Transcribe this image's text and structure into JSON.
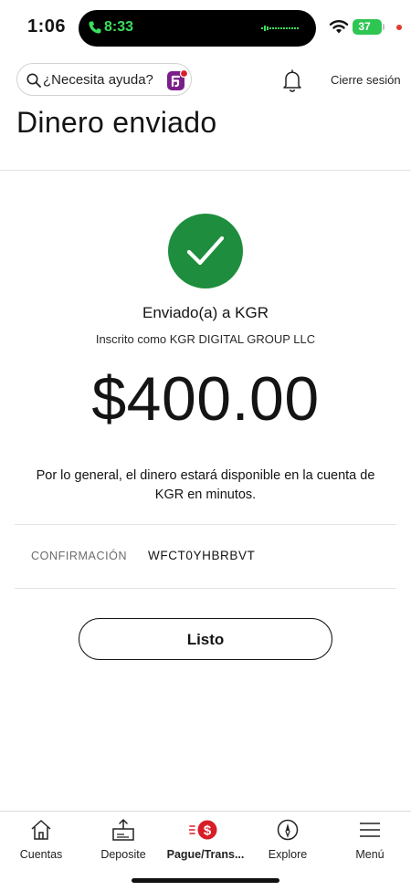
{
  "status_bar": {
    "time": "1:06",
    "call_time": "8:33",
    "battery": "37"
  },
  "header": {
    "search_placeholder": "¿Necesita ayuda?",
    "signout": "Cierre sesión"
  },
  "page": {
    "title": "Dinero enviado"
  },
  "confirmation": {
    "sent_to": "Enviado(a) a KGR",
    "enrolled_as": "Inscrito como KGR DIGITAL GROUP LLC",
    "amount": "$400.00",
    "note": "Por lo general, el dinero estará disponible en la cuenta de KGR en minutos.",
    "code_label": "CONFIRMACIÓN",
    "code_value": "WFCT0YHBRBVT",
    "done_label": "Listo"
  },
  "tabs": [
    {
      "label": "Cuentas",
      "icon": "home-icon"
    },
    {
      "label": "Deposite",
      "icon": "deposit-icon"
    },
    {
      "label": "Pague/Trans...",
      "icon": "pay-transfer-icon",
      "active": true
    },
    {
      "label": "Explore",
      "icon": "compass-icon"
    },
    {
      "label": "Menú",
      "icon": "hamburger-menu-icon"
    }
  ],
  "colors": {
    "success_green": "#1e8e3e",
    "brand_red": "#d71e28",
    "call_green": "#3adf5b",
    "battery_green": "#2fc553"
  }
}
